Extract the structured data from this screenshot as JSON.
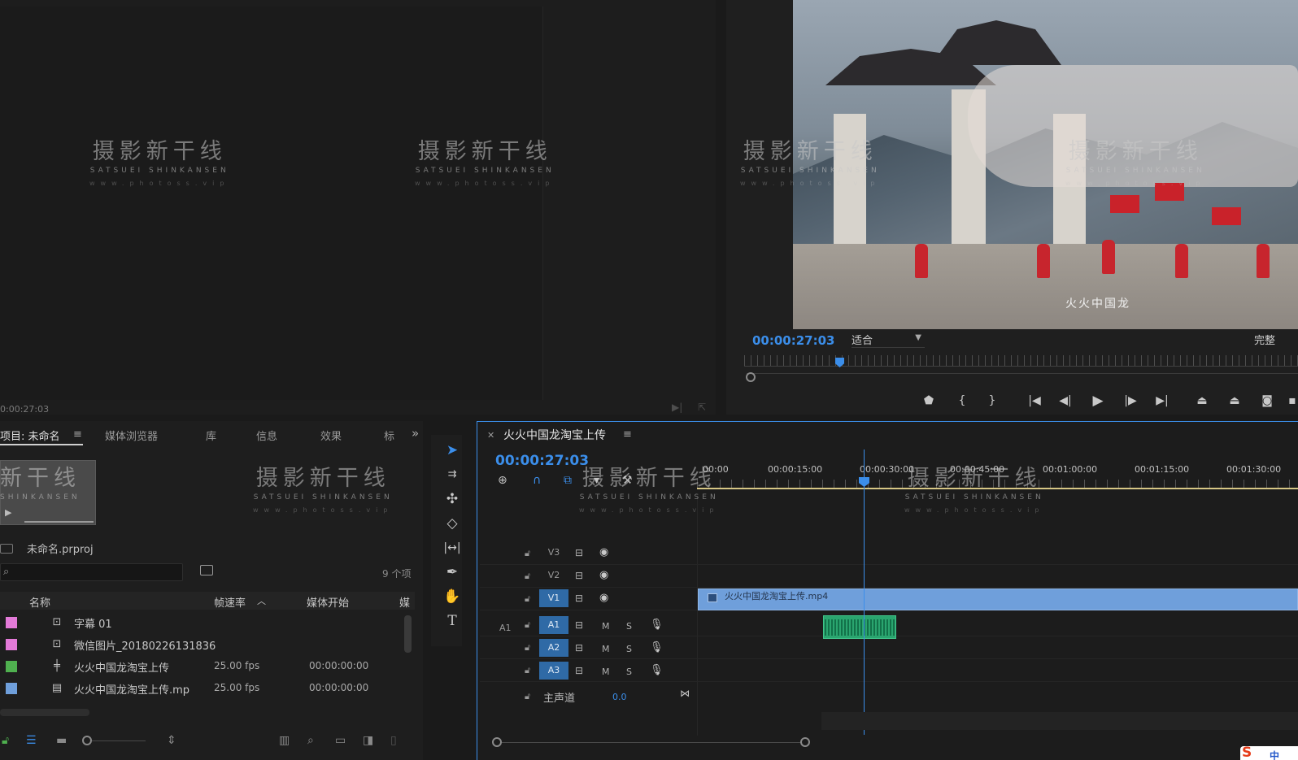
{
  "source_monitor": {
    "timecode": "0:00:27:03"
  },
  "program_monitor": {
    "timecode": "00:00:27:03",
    "fit_select": "适合",
    "quality_select": "完整",
    "video_caption": "火火中国龙",
    "controls": [
      "add-marker",
      "mark-in",
      "mark-out",
      "go-to-in",
      "step-back",
      "play",
      "step-forward",
      "go-to-out",
      "lift",
      "extract",
      "export-frame",
      "overflow"
    ]
  },
  "project_panel": {
    "tabs": [
      "项目: 未命名",
      "媒体浏览器",
      "库",
      "信息",
      "效果",
      "标"
    ],
    "project_file": "未命名.prproj",
    "search_value": "",
    "item_count": "9 个项",
    "columns": {
      "name": "名称",
      "frame_rate": "帧速率",
      "media_start": "媒体开始",
      "media_more": "媒"
    },
    "items": [
      {
        "name": "字幕 01",
        "fps": "",
        "start": "",
        "color": "#e37ad8",
        "icon": "title-icon"
      },
      {
        "name": "微信图片_20180226131836",
        "fps": "",
        "start": "",
        "color": "#e37ad8",
        "icon": "image-icon"
      },
      {
        "name": "火火中国龙淘宝上传",
        "fps": "25.00 fps",
        "start": "00:00:00:00",
        "color": "#4fb04f",
        "icon": "sequence-icon"
      },
      {
        "name": "火火中国龙淘宝上传.mp",
        "fps": "25.00 fps",
        "start": "00:00:00:00",
        "color": "#6f9fdb",
        "icon": "video-file-icon"
      }
    ]
  },
  "tools": [
    "selection",
    "track-select",
    "ripple-edit",
    "razor",
    "slip",
    "pen",
    "hand",
    "type"
  ],
  "timeline": {
    "sequence_name": "火火中国龙淘宝上传",
    "timecode": "00:00:27:03",
    "ruler_labels": [
      "00:00",
      "00:00:15:00",
      "00:00:30:00",
      "00:00:45:00",
      "00:01:00:00",
      "00:01:15:00",
      "00:01:30:00"
    ],
    "video_tracks": [
      "V3",
      "V2",
      "V1"
    ],
    "audio_tracks": [
      "A1",
      "A2",
      "A3"
    ],
    "source_patch": "A1",
    "mute_label": "M",
    "solo_label": "S",
    "video_clip_label": "火火中国龙淘宝上传.mp4",
    "master_label": "主声道",
    "master_volume": "0.0"
  },
  "watermark": {
    "zh": "摄影新干线",
    "en": "SATSUEI SHINKANSEN",
    "url": "www.photoss.vip",
    "zh_partial": "新干线",
    "en_partial": "SHINKANSEN"
  },
  "ime": {
    "brand": "S",
    "lang": "中"
  },
  "colors": {
    "accent": "#3b8eea",
    "video_clip": "#6f9fdb",
    "audio_clip": "#2aa56f",
    "work_area": "#d6c685"
  }
}
